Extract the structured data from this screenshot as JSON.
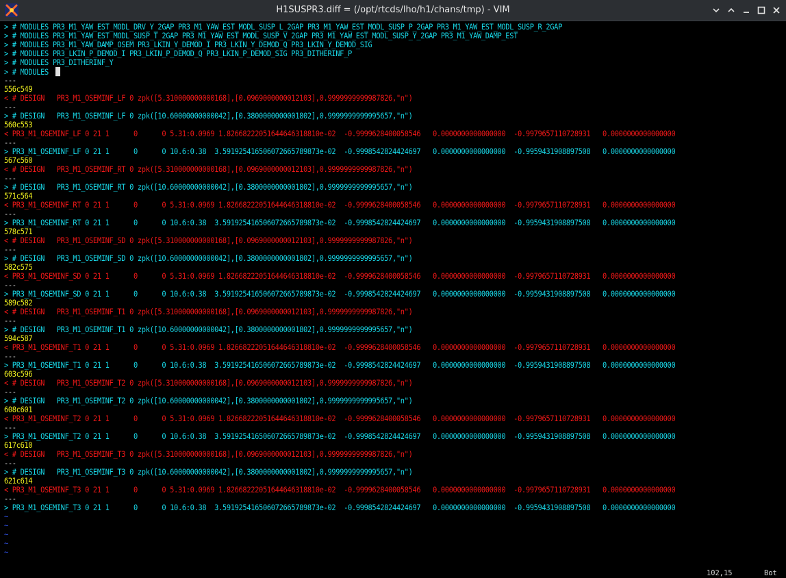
{
  "window": {
    "title": "H1SUSPR3.diff = (/opt/rtcds/lho/h1/chans/tmp) - VIM",
    "icon": "vim-icon",
    "controls": [
      "chevron-down-icon",
      "chevron-up-icon",
      "minimize-icon",
      "maximize-icon",
      "close-icon"
    ]
  },
  "colors": {
    "background": "#000000",
    "added": "#18d8e8",
    "removed": "#f01818",
    "hunk": "#f0f020",
    "separator": "#cfcfcf",
    "tilde": "#3050e0"
  },
  "lines": [
    {
      "t": "> # MODULES PR3_M1_YAW_EST_MODL_DRV_Y_2GAP PR3_M1_YAW_EST_MODL_SUSP_L_2GAP PR3_M1_YAW_EST_MODL_SUSP_P_2GAP PR3_M1_YAW_EST_MODL_SUSP_R_2GAP",
      "c": "cyan"
    },
    {
      "t": "> # MODULES PR3_M1_YAW_EST_MODL_SUSP_T_2GAP PR3_M1_YAW_EST_MODL_SUSP_V_2GAP PR3_M1_YAW_EST_MODL_SUSP_Y_2GAP PR3_M1_YAW_DAMP_EST",
      "c": "cyan"
    },
    {
      "t": "> # MODULES PR3_M1_YAW_DAMP_OSEM PR3_LKIN_Y_DEMOD_I PR3_LKIN_Y_DEMOD_Q PR3_LKIN_Y_DEMOD_SIG",
      "c": "cyan"
    },
    {
      "t": "> # MODULES PR3_LKIN_P_DEMOD_I PR3_LKIN_P_DEMOD_Q PR3_LKIN_P_DEMOD_SIG PR3_DITHERINF_P",
      "c": "cyan"
    },
    {
      "t": "> # MODULES PR3_DITHERINF_Y",
      "c": "cyan"
    },
    {
      "t": "> # MODULES",
      "c": "cyan",
      "cursor": true
    },
    {
      "t": "---",
      "c": "white"
    },
    {
      "t": "556c549",
      "c": "yellow"
    },
    {
      "t": "< # DESIGN   PR3_M1_OSEMINF_LF 0 zpk([5.310000000000168],[0.0969000000012103],0.9999999999987826,\"n\")",
      "c": "red"
    },
    {
      "t": "---",
      "c": "white"
    },
    {
      "t": "> # DESIGN   PR3_M1_OSEMINF_LF 0 zpk([10.60000000000042],[0.3800000000001802],0.9999999999995657,\"n\")",
      "c": "cyan"
    },
    {
      "t": "560c553",
      "c": "yellow"
    },
    {
      "t": "< PR3_M1_OSEMINF_LF 0 21 1      0      0 5.31:0.0969 1.8266822205164464631881​0e-02  -0.9999628400058546   0.0000000000000000  -0.9979657110728931   0.0000000000000000",
      "c": "red"
    },
    {
      "t": "---",
      "c": "white"
    },
    {
      "t": "> PR3_M1_OSEMINF_LF 0 21 1      0      0 10.6:0.38  3.5919254165060726657898​73e-02  -0.9998542824424697   0.0000000000000000  -0.9959431908897508   0.0000000000000000",
      "c": "cyan"
    },
    {
      "t": "567c560",
      "c": "yellow"
    },
    {
      "t": "< # DESIGN   PR3_M1_OSEMINF_RT 0 zpk([5.310000000000168],[0.0969000000012103],0.9999999999987826,\"n\")",
      "c": "red"
    },
    {
      "t": "---",
      "c": "white"
    },
    {
      "t": "> # DESIGN   PR3_M1_OSEMINF_RT 0 zpk([10.60000000000042],[0.3800000000001802],0.9999999999995657,\"n\")",
      "c": "cyan"
    },
    {
      "t": "571c564",
      "c": "yellow"
    },
    {
      "t": "< PR3_M1_OSEMINF_RT 0 21 1      0      0 5.31:0.0969 1.8266822205164464631881​0e-02  -0.9999628400058546   0.0000000000000000  -0.9979657110728931   0.0000000000000000",
      "c": "red"
    },
    {
      "t": "---",
      "c": "white"
    },
    {
      "t": "> PR3_M1_OSEMINF_RT 0 21 1      0      0 10.6:0.38  3.5919254165060726657898​73e-02  -0.9998542824424697   0.0000000000000000  -0.9959431908897508   0.0000000000000000",
      "c": "cyan"
    },
    {
      "t": "578c571",
      "c": "yellow"
    },
    {
      "t": "< # DESIGN   PR3_M1_OSEMINF_SD 0 zpk([5.310000000000168],[0.0969000000012103],0.9999999999987826,\"n\")",
      "c": "red"
    },
    {
      "t": "---",
      "c": "white"
    },
    {
      "t": "> # DESIGN   PR3_M1_OSEMINF_SD 0 zpk([10.60000000000042],[0.3800000000001802],0.9999999999995657,\"n\")",
      "c": "cyan"
    },
    {
      "t": "582c575",
      "c": "yellow"
    },
    {
      "t": "< PR3_M1_OSEMINF_SD 0 21 1      0      0 5.31:0.0969 1.8266822205164464631881​0e-02  -0.9999628400058546   0.0000000000000000  -0.9979657110728931   0.0000000000000000",
      "c": "red"
    },
    {
      "t": "---",
      "c": "white"
    },
    {
      "t": "> PR3_M1_OSEMINF_SD 0 21 1      0      0 10.6:0.38  3.5919254165060726657898​73e-02  -0.9998542824424697   0.0000000000000000  -0.9959431908897508   0.0000000000000000",
      "c": "cyan"
    },
    {
      "t": "589c582",
      "c": "yellow"
    },
    {
      "t": "< # DESIGN   PR3_M1_OSEMINF_T1 0 zpk([5.310000000000168],[0.0969000000012103],0.9999999999987826,\"n\")",
      "c": "red"
    },
    {
      "t": "---",
      "c": "white"
    },
    {
      "t": "> # DESIGN   PR3_M1_OSEMINF_T1 0 zpk([10.60000000000042],[0.3800000000001802],0.9999999999995657,\"n\")",
      "c": "cyan"
    },
    {
      "t": "594c587",
      "c": "yellow"
    },
    {
      "t": "< PR3_M1_OSEMINF_T1 0 21 1      0      0 5.31:0.0969 1.8266822205164464631881​0e-02  -0.9999628400058546   0.0000000000000000  -0.9979657110728931   0.0000000000000000",
      "c": "red"
    },
    {
      "t": "---",
      "c": "white"
    },
    {
      "t": "> PR3_M1_OSEMINF_T1 0 21 1      0      0 10.6:0.38  3.5919254165060726657898​73e-02  -0.9998542824424697   0.0000000000000000  -0.9959431908897508   0.0000000000000000",
      "c": "cyan"
    },
    {
      "t": "603c596",
      "c": "yellow"
    },
    {
      "t": "< # DESIGN   PR3_M1_OSEMINF_T2 0 zpk([5.310000000000168],[0.0969000000012103],0.9999999999987826,\"n\")",
      "c": "red"
    },
    {
      "t": "---",
      "c": "white"
    },
    {
      "t": "> # DESIGN   PR3_M1_OSEMINF_T2 0 zpk([10.60000000000042],[0.3800000000001802],0.9999999999995657,\"n\")",
      "c": "cyan"
    },
    {
      "t": "608c601",
      "c": "yellow"
    },
    {
      "t": "< PR3_M1_OSEMINF_T2 0 21 1      0      0 5.31:0.0969 1.8266822205164464631881​0e-02  -0.9999628400058546   0.0000000000000000  -0.9979657110728931   0.0000000000000000",
      "c": "red"
    },
    {
      "t": "---",
      "c": "white"
    },
    {
      "t": "> PR3_M1_OSEMINF_T2 0 21 1      0      0 10.6:0.38  3.5919254165060726657898​73e-02  -0.9998542824424697   0.0000000000000000  -0.9959431908897508   0.0000000000000000",
      "c": "cyan"
    },
    {
      "t": "617c610",
      "c": "yellow"
    },
    {
      "t": "< # DESIGN   PR3_M1_OSEMINF_T3 0 zpk([5.310000000000168],[0.0969000000012103],0.9999999999987826,\"n\")",
      "c": "red"
    },
    {
      "t": "---",
      "c": "white"
    },
    {
      "t": "> # DESIGN   PR3_M1_OSEMINF_T3 0 zpk([10.60000000000042],[0.3800000000001802],0.9999999999995657,\"n\")",
      "c": "cyan"
    },
    {
      "t": "621c614",
      "c": "yellow"
    },
    {
      "t": "< PR3_M1_OSEMINF_T3 0 21 1      0      0 5.31:0.0969 1.8266822205164464631881​0e-02  -0.9999628400058546   0.0000000000000000  -0.9979657110728931   0.0000000000000000",
      "c": "red"
    },
    {
      "t": "---",
      "c": "white"
    },
    {
      "t": "> PR3_M1_OSEMINF_T3 0 21 1      0      0 10.6:0.38  3.5919254165060726657898​73e-02  -0.9998542824424697   0.0000000000000000  -0.9959431908897508   0.0000000000000000",
      "c": "cyan"
    },
    {
      "t": "~",
      "c": "tilde"
    },
    {
      "t": "~",
      "c": "tilde"
    },
    {
      "t": "~",
      "c": "tilde"
    },
    {
      "t": "~",
      "c": "tilde"
    },
    {
      "t": "~",
      "c": "tilde"
    }
  ],
  "status": {
    "position": "102,15",
    "scroll": "Bot"
  }
}
